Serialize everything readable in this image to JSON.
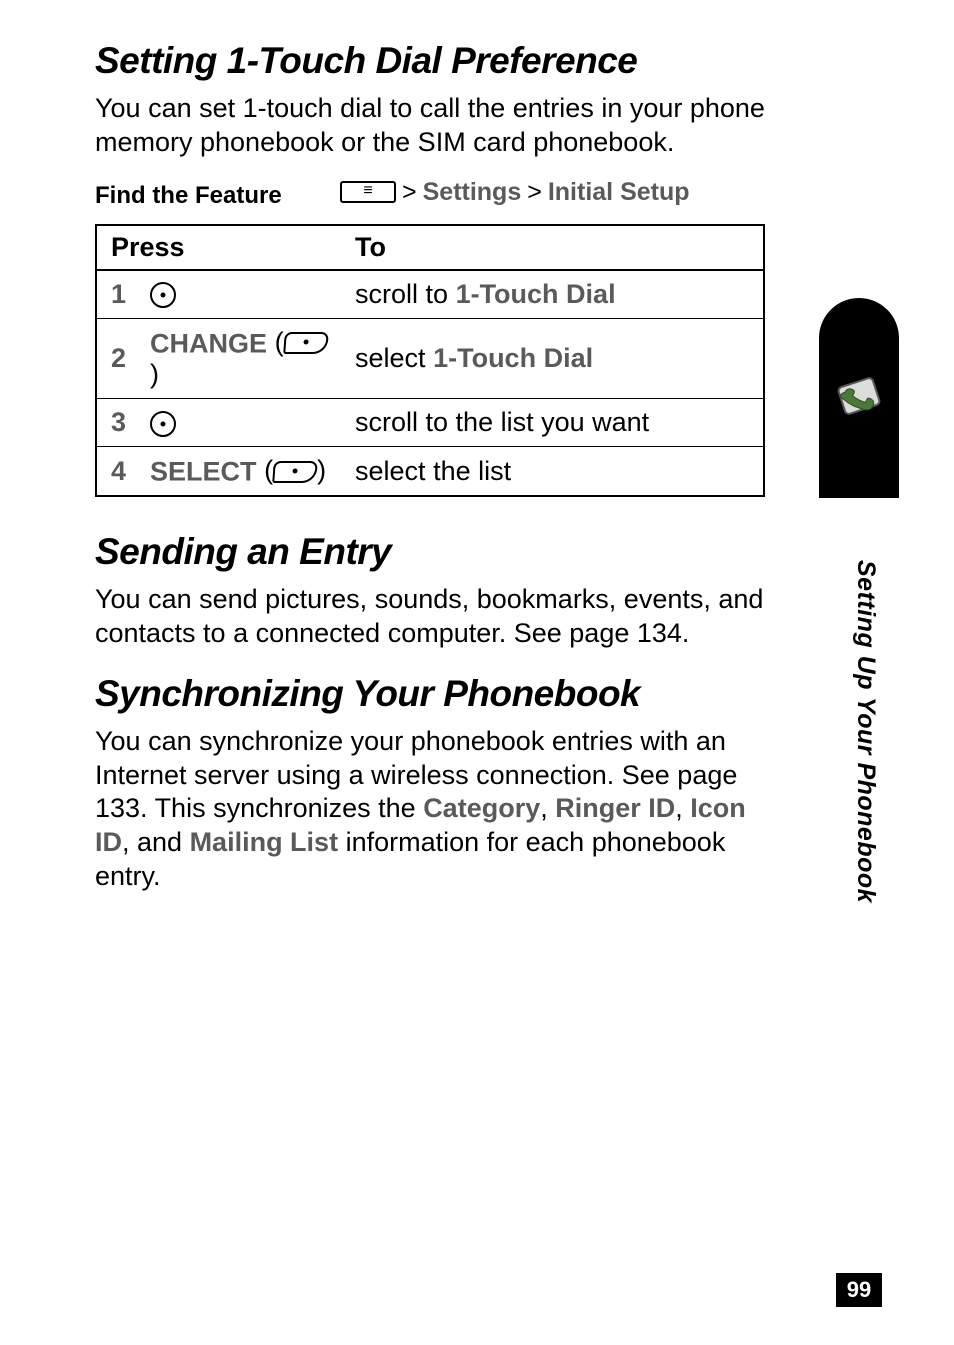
{
  "page_number": "99",
  "side_tab_label": "Setting Up Your Phonebook",
  "section1": {
    "title": "Setting 1-Touch Dial Preference",
    "intro": "You can set 1-touch dial to call the entries in your phone memory phonebook or the SIM card phonebook.",
    "find_feature_label": "Find the Feature",
    "path_gt1": ">",
    "path_item1": "Settings",
    "path_gt2": ">",
    "path_item2": "Initial Setup",
    "table": {
      "header_press": "Press",
      "header_to": "To",
      "rows": [
        {
          "num": "1",
          "press_icon": "nav",
          "press_text_pre": "",
          "press_text_post": "",
          "to_pre": "scroll to ",
          "to_bold": "1-Touch Dial",
          "to_post": ""
        },
        {
          "num": "2",
          "press_icon": "softkey",
          "press_text_pre": "CHANGE",
          "press_text_post": "",
          "to_pre": "select ",
          "to_bold": "1-Touch Dial",
          "to_post": ""
        },
        {
          "num": "3",
          "press_icon": "nav",
          "press_text_pre": "",
          "press_text_post": "",
          "to_pre": "scroll to the list you want",
          "to_bold": "",
          "to_post": ""
        },
        {
          "num": "4",
          "press_icon": "softkey",
          "press_text_pre": "SELECT",
          "press_text_post": "",
          "to_pre": "select the list",
          "to_bold": "",
          "to_post": ""
        }
      ]
    }
  },
  "section2": {
    "title": "Sending an Entry",
    "body": "You can send pictures, sounds, bookmarks, events, and contacts to a connected computer. See page 134."
  },
  "section3": {
    "title": "Synchronizing Your Phonebook",
    "body_pre": "You can synchronize your phonebook entries with an Internet server using a wireless connection. See page 133. This synchronizes the ",
    "t1": "Category",
    "c1": ", ",
    "t2": "Ringer ID",
    "c2": ", ",
    "t3": "Icon ID",
    "c3": ", and ",
    "t4": "Mailing List",
    "body_post": " information for each phonebook entry."
  }
}
